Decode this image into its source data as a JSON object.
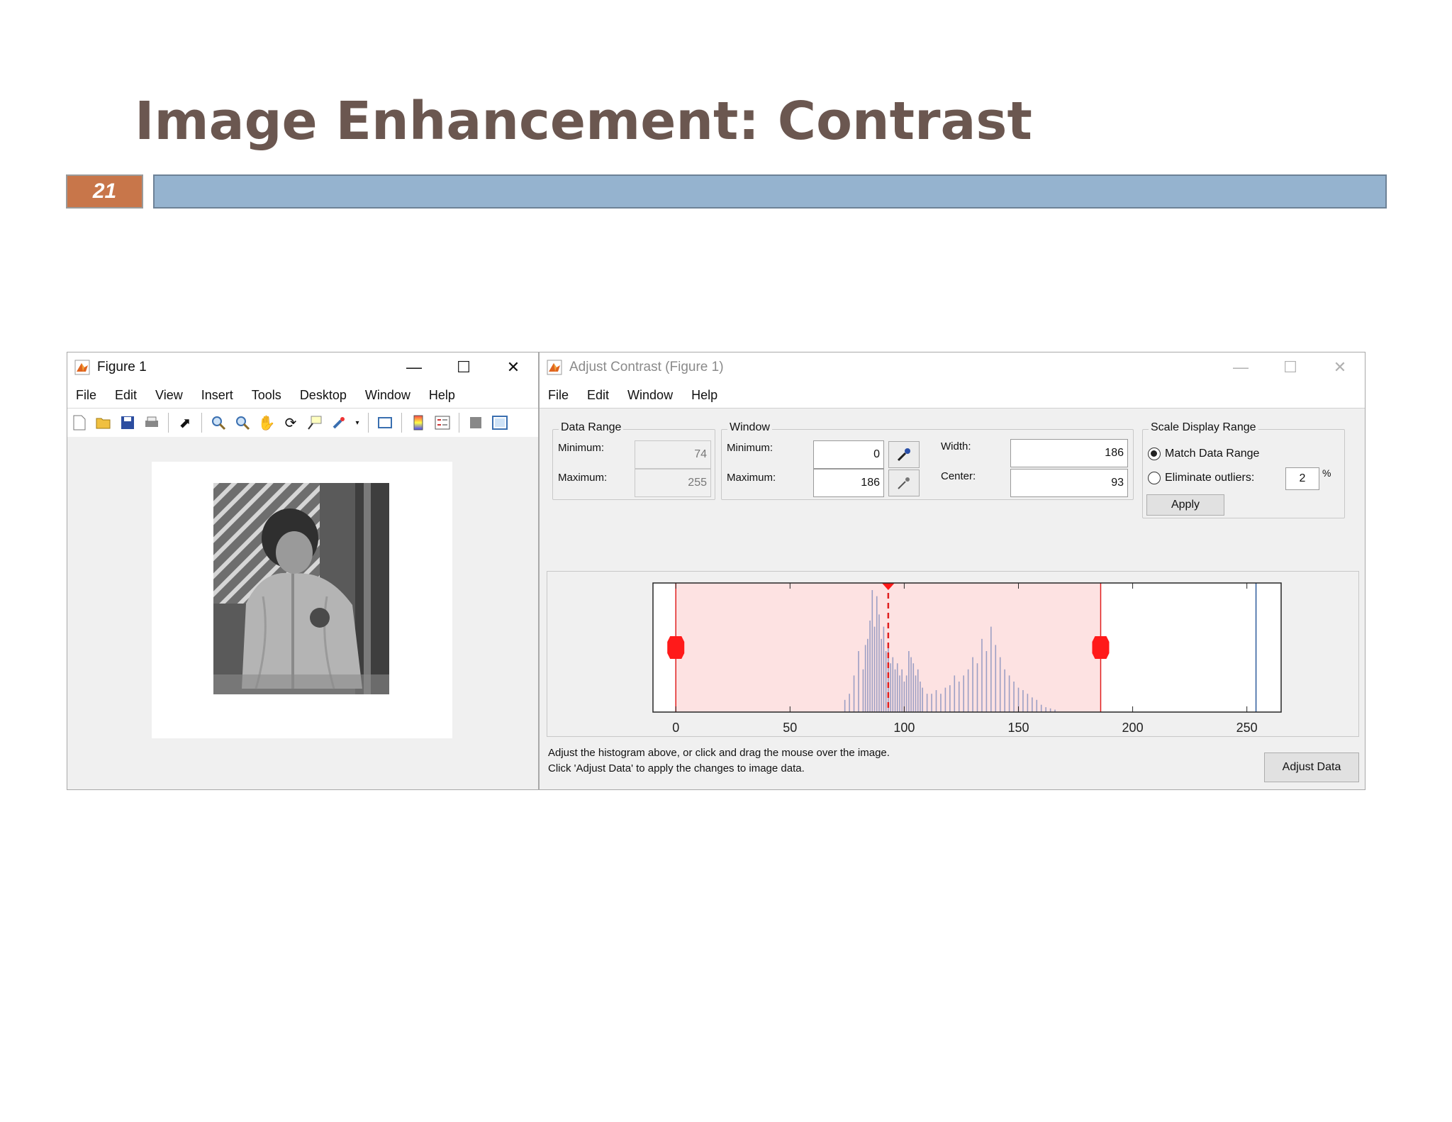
{
  "slide": {
    "title": "Image Enhancement: Contrast",
    "number": "21"
  },
  "colors": {
    "title": "#6b5750",
    "number_box": "#c8764a",
    "title_bar": "#95b3cf",
    "window_region": "#fde2e2",
    "handle": "#ff1a1a"
  },
  "figure_window": {
    "title": "Figure 1",
    "menu": [
      "File",
      "Edit",
      "View",
      "Insert",
      "Tools",
      "Desktop",
      "Window",
      "Help"
    ],
    "toolbar_icons": [
      "new-file-icon",
      "open-folder-icon",
      "save-icon",
      "print-icon",
      "pointer-icon",
      "zoom-in-icon",
      "zoom-out-icon",
      "pan-hand-icon",
      "rotate-3d-icon",
      "data-cursor-icon",
      "brush-icon",
      "link-plot-icon",
      "colorbar-icon",
      "legend-icon",
      "hide-plot-tools-icon",
      "show-plot-tools-icon"
    ],
    "image_description_icon": "grayscale-photo-child"
  },
  "contrast_window": {
    "title": "Adjust Contrast (Figure 1)",
    "menu": [
      "File",
      "Edit",
      "Window",
      "Help"
    ],
    "data_range": {
      "label": "Data Range",
      "min_label": "Minimum:",
      "min": "74",
      "max_label": "Maximum:",
      "max": "255"
    },
    "window": {
      "label": "Window",
      "min_label": "Minimum:",
      "min": "0",
      "max_label": "Maximum:",
      "max": "186",
      "width_label": "Width:",
      "width": "186",
      "center_label": "Center:",
      "center": "93"
    },
    "scale": {
      "label": "Scale Display Range",
      "match_label": "Match Data Range",
      "match_selected": true,
      "eliminate_label": "Eliminate outliers:",
      "eliminate_selected": false,
      "outlier_value": "2",
      "percent": "%",
      "apply_label": "Apply"
    },
    "help_line1": "Adjust the histogram above, or click and drag the mouse over the image.",
    "help_line2": "Click 'Adjust Data' to apply the changes to image data.",
    "adjust_button": "Adjust Data"
  },
  "chart_data": {
    "type": "bar",
    "xlim": [
      -10,
      265
    ],
    "xticks": [
      "0",
      "50",
      "100",
      "150",
      "200",
      "250"
    ],
    "xtick_values": [
      0,
      50,
      100,
      150,
      200,
      250
    ],
    "window_min": 0,
    "window_max": 186,
    "window_center": 93,
    "bins": [
      74,
      76,
      78,
      80,
      82,
      83,
      84,
      85,
      86,
      87,
      88,
      89,
      90,
      91,
      92,
      93,
      94,
      95,
      96,
      97,
      98,
      99,
      100,
      101,
      102,
      103,
      104,
      105,
      106,
      107,
      108,
      110,
      112,
      114,
      116,
      118,
      120,
      122,
      124,
      126,
      128,
      130,
      132,
      134,
      136,
      138,
      140,
      142,
      144,
      146,
      148,
      150,
      152,
      154,
      156,
      158,
      160,
      162,
      164,
      166
    ],
    "counts": [
      0.1,
      0.15,
      0.3,
      0.5,
      0.35,
      0.55,
      0.6,
      0.75,
      1.0,
      0.7,
      0.95,
      0.8,
      0.6,
      0.7,
      0.5,
      0.55,
      0.4,
      0.45,
      0.35,
      0.4,
      0.3,
      0.35,
      0.25,
      0.3,
      0.5,
      0.45,
      0.4,
      0.3,
      0.35,
      0.25,
      0.2,
      0.15,
      0.15,
      0.18,
      0.15,
      0.2,
      0.22,
      0.3,
      0.25,
      0.3,
      0.35,
      0.45,
      0.4,
      0.6,
      0.5,
      0.7,
      0.55,
      0.45,
      0.35,
      0.3,
      0.25,
      0.2,
      0.18,
      0.15,
      0.12,
      0.1,
      0.06,
      0.04,
      0.03,
      0.02
    ],
    "ref_line": 254
  }
}
